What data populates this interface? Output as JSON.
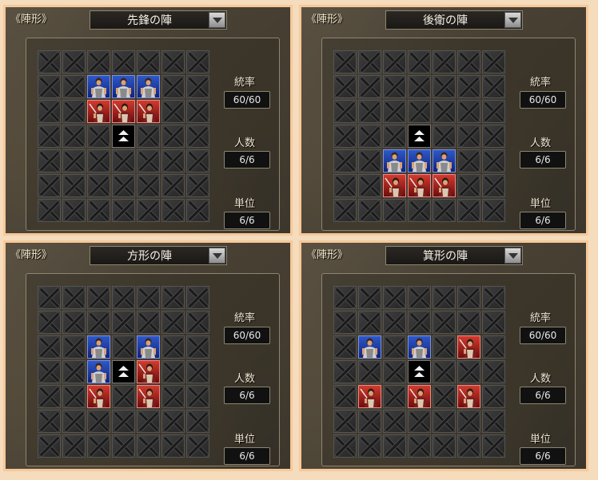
{
  "panels": [
    {
      "title": "《陣形》",
      "formation": "先鋒の陣",
      "stats": {
        "command_label": "統率",
        "command_value": "60/60",
        "people_label": "人数",
        "people_value": "6/6",
        "unit_label": "単位",
        "unit_value": "6/6"
      },
      "grid": [
        "EEEEEEE",
        "EEBBBEE",
        "EERRREE",
        "EEELEEE",
        "EEEEEEE",
        "EEEEEEE",
        "EEEEEEE"
      ]
    },
    {
      "title": "《陣形》",
      "formation": "後衛の陣",
      "stats": {
        "command_label": "統率",
        "command_value": "60/60",
        "people_label": "人数",
        "people_value": "6/6",
        "unit_label": "単位",
        "unit_value": "6/6"
      },
      "grid": [
        "EEEEEEE",
        "EEEEEEE",
        "EEEEEEE",
        "EEELEEE",
        "EEBBBEE",
        "EERRREE",
        "EEEEEEE"
      ]
    },
    {
      "title": "《陣形》",
      "formation": "方形の陣",
      "stats": {
        "command_label": "統率",
        "command_value": "60/60",
        "people_label": "人数",
        "people_value": "6/6",
        "unit_label": "単位",
        "unit_value": "6/6"
      },
      "grid": [
        "EEEEEEE",
        "EEEEEEE",
        "EEBEBEE",
        "EEBLREE",
        "EEREREE",
        "EEEEEEE",
        "EEEEEEE"
      ]
    },
    {
      "title": "《陣形》",
      "formation": "箕形の陣",
      "stats": {
        "command_label": "統率",
        "command_value": "60/60",
        "people_label": "人数",
        "people_value": "6/6",
        "unit_label": "単位",
        "unit_value": "6/6"
      },
      "grid": [
        "EEEEEEE",
        "EEEEEEE",
        "EBEBERE",
        "EEELEEE",
        "ERERERE",
        "EEEEEEE",
        "EEEEEEE"
      ]
    }
  ],
  "colors": {
    "blue_unit": "#2e58c9",
    "red_unit": "#d23b2e",
    "leader": "#000000"
  },
  "icons": {
    "dropdown": "chevron-down-icon",
    "leader": "double-chevron-up-icon",
    "empty": "x-cross-icon"
  }
}
